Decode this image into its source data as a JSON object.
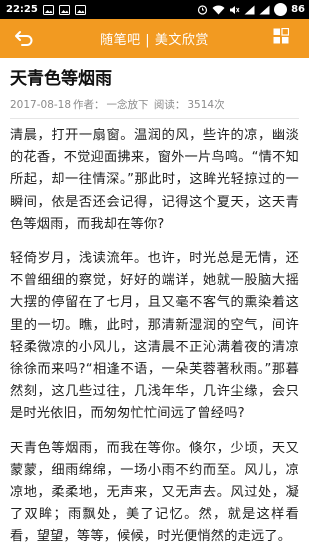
{
  "status_bar": {
    "time": "22:25",
    "battery": "86"
  },
  "app_bar": {
    "title": "随笔吧 | 美文欣赏",
    "back_icon": "back-arrow-icon",
    "menu_icon": "grid-icon"
  },
  "article": {
    "title": "天青色等烟雨",
    "date": "2017-08-18",
    "author_label": "作者：",
    "author": "一念放下",
    "reads_label": "阅读：",
    "reads": "3514次",
    "paragraphs": [
      "清晨，打开一扇窗。温润的风，些许的凉，幽淡的花香，不觉迎面拂来，窗外一片鸟鸣。“情不知所起，却一往情深。”那此时，这眸光轻掠过的一瞬间，依是否还会记得，记得这个夏天，这天青色等烟雨，而我却在等你?",
      "轻倚岁月，浅读流年。也许，时光总是无情，还不曾细细的察觉，好好的端详，她就一股脑大摇大摆的停留在了七月，且又毫不客气的熏染着这里的一切。瞧，此时，那清新湿润的空气，间许轻柔微凉的小风儿，这清晨不正沁满着夜的清凉徐徐而来吗?“相逢不语，一朵芙蓉著秋雨。”那暮然刻，这几些过往，几浅年华，几许尘缘，会只是时光依旧，而匆匆忙忙间远了曾经吗?",
      "天青色等烟雨，而我在等你。倏尔，少顷，天又蒙蒙，细雨绵绵，一场小雨不约而至。风儿，凉凉地，柔柔地，无声来，又无声去。风过处，凝了双眸；雨飘处，美了记忆。然，就是这样看看，望望，等等，候候，时光便悄然的走远了。"
    ]
  }
}
